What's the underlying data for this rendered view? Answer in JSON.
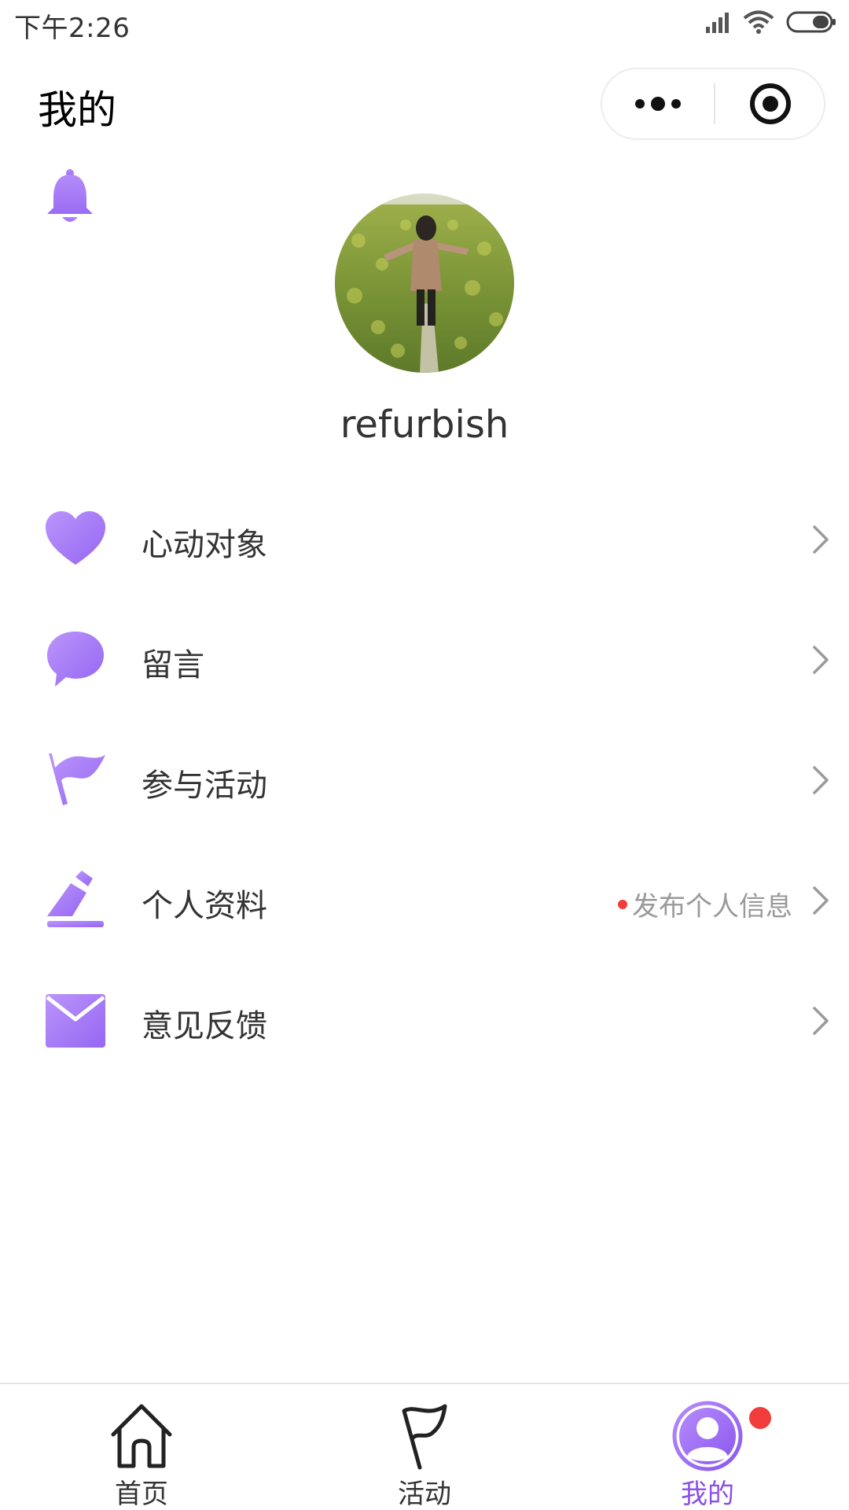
{
  "status_bar": {
    "time": "下午2:26"
  },
  "nav": {
    "title": "我的"
  },
  "profile": {
    "username": "refurbish"
  },
  "menu": {
    "items": [
      {
        "label": "心动对象",
        "icon": "heart-icon"
      },
      {
        "label": "留言",
        "icon": "chat-bubble-icon"
      },
      {
        "label": "参与活动",
        "icon": "flag-icon"
      },
      {
        "label": "个人资料",
        "icon": "edit-profile-icon",
        "hint": "发布个人信息"
      },
      {
        "label": "意见反馈",
        "icon": "mail-icon"
      }
    ]
  },
  "tabbar": {
    "tabs": [
      {
        "label": "首页",
        "icon": "home-icon"
      },
      {
        "label": "活动",
        "icon": "flag-outline-icon"
      },
      {
        "label": "我的",
        "icon": "user-icon",
        "active": true
      }
    ]
  },
  "colors": {
    "accent": "#8a4fe8",
    "icon_purple": "#a57cf7",
    "badge_red": "#f23c3c",
    "hint_gray": "#999999"
  }
}
